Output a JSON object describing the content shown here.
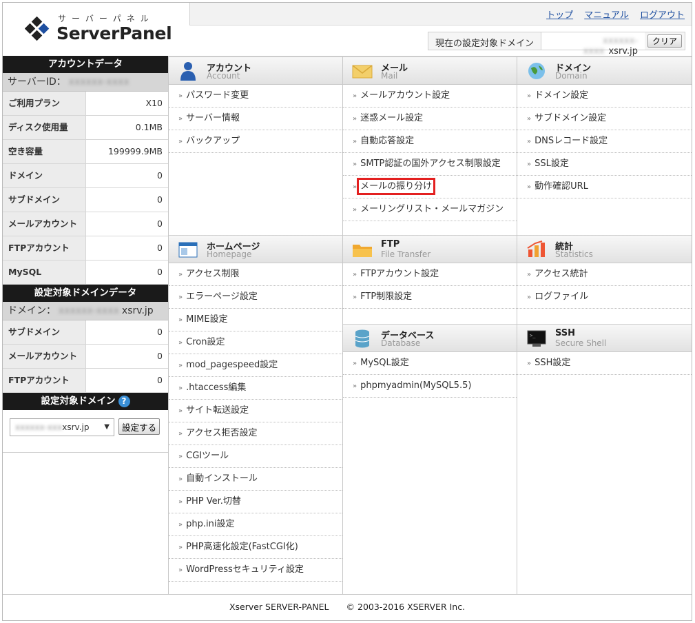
{
  "header": {
    "logo_kana": "サーバーパネル",
    "logo_name": "ServerPanel",
    "nav": [
      "トップ",
      "マニュアル",
      "ログアウト"
    ],
    "domain_label": "現在の設定対象ドメイン",
    "domain_blurred": "xxxxxx-xxxx",
    "domain_value": "xsrv.jp",
    "clear_button": "クリア"
  },
  "sidebar": {
    "account_head": "アカウントデータ",
    "server_id_label": "サーバーID：",
    "server_id_blurred": "xxxxxx-xxxx",
    "account_rows": [
      {
        "k": "ご利用プラン",
        "v": "X10"
      },
      {
        "k": "ディスク使用量",
        "v": "0.1MB"
      },
      {
        "k": "空き容量",
        "v": "199999.9MB"
      },
      {
        "k": "ドメイン",
        "v": "0"
      },
      {
        "k": "サブドメイン",
        "v": "0"
      },
      {
        "k": "メールアカウント",
        "v": "0"
      },
      {
        "k": "FTPアカウント",
        "v": "0"
      },
      {
        "k": "MySQL",
        "v": "0"
      }
    ],
    "domain_head": "設定対象ドメインデータ",
    "domain_label": "ドメイン：",
    "domain_blurred": "xxxxxx-xxxx",
    "domain_value": "xsrv.jp",
    "domain_rows": [
      {
        "k": "サブドメイン",
        "v": "0"
      },
      {
        "k": "メールアカウント",
        "v": "0"
      },
      {
        "k": "FTPアカウント",
        "v": "0"
      }
    ],
    "target_head": "設定対象ドメイン",
    "target_q": "?",
    "select_blurred": "xxxxxx-xxx",
    "select_value": "xsrv.jp",
    "select_arrow": "▼",
    "set_button": "設定する"
  },
  "sections": {
    "account": {
      "title": "アカウント",
      "sub": "Account",
      "items": [
        "パスワード変更",
        "サーバー情報",
        "バックアップ"
      ]
    },
    "mail": {
      "title": "メール",
      "sub": "Mail",
      "items": [
        "メールアカウント設定",
        "迷惑メール設定",
        "自動応答設定",
        "SMTP認証の国外アクセス制限設定",
        "メールの振り分け",
        "メーリングリスト・メールマガジン"
      ]
    },
    "domain": {
      "title": "ドメイン",
      "sub": "Domain",
      "items": [
        "ドメイン設定",
        "サブドメイン設定",
        "DNSレコード設定",
        "SSL設定",
        "動作確認URL"
      ]
    },
    "homepage": {
      "title": "ホームページ",
      "sub": "Homepage",
      "items": [
        "アクセス制限",
        "エラーページ設定",
        "MIME設定",
        "Cron設定",
        "mod_pagespeed設定",
        ".htaccess編集",
        "サイト転送設定",
        "アクセス拒否設定",
        "CGIツール",
        "自動インストール",
        "PHP Ver.切替",
        "php.ini設定",
        "PHP高速化設定(FastCGI化)",
        "WordPressセキュリティ設定"
      ]
    },
    "ftp": {
      "title": "FTP",
      "sub": "File Transfer",
      "items": [
        "FTPアカウント設定",
        "FTP制限設定"
      ]
    },
    "stats": {
      "title": "統計",
      "sub": "Statistics",
      "items": [
        "アクセス統計",
        "ログファイル"
      ]
    },
    "database": {
      "title": "データベース",
      "sub": "Database",
      "items": [
        "MySQL設定",
        "phpmyadmin(MySQL5.5)"
      ]
    },
    "ssh": {
      "title": "SSH",
      "sub": "Secure Shell",
      "items": [
        "SSH設定"
      ]
    }
  },
  "footer": "Xserver SERVER-PANEL　　© 2003-2016 XSERVER Inc.",
  "arrow_glyph": "»"
}
